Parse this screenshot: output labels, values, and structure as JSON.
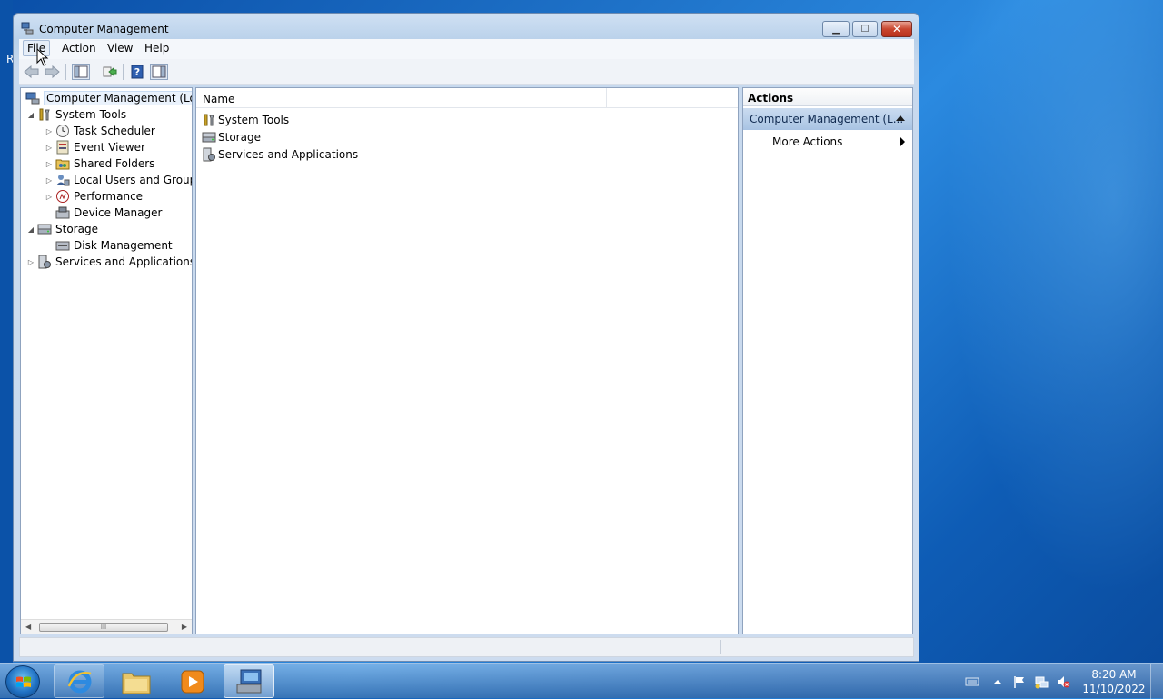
{
  "desktop": {
    "edge_letter": "R"
  },
  "window": {
    "title": "Computer Management",
    "icon": "computer-management-icon",
    "caption_buttons": [
      "minimize",
      "maximize",
      "close"
    ]
  },
  "menu": {
    "file": "File",
    "action": "Action",
    "view": "View",
    "help": "Help"
  },
  "toolbar": {
    "icons": [
      "back-arrow-icon",
      "forward-arrow-icon",
      "show-hide-console-tree-icon",
      "export-list-icon",
      "help-icon",
      "show-hide-action-pane-icon"
    ]
  },
  "tree": {
    "root": "Computer Management (Local",
    "items": [
      {
        "label": "System Tools",
        "icon": "system-tools-icon"
      },
      {
        "label": "Task Scheduler",
        "icon": "task-scheduler-icon"
      },
      {
        "label": "Event Viewer",
        "icon": "event-viewer-icon"
      },
      {
        "label": "Shared Folders",
        "icon": "shared-folders-icon"
      },
      {
        "label": "Local Users and Groups",
        "icon": "local-users-icon"
      },
      {
        "label": "Performance",
        "icon": "performance-icon"
      },
      {
        "label": "Device Manager",
        "icon": "device-manager-icon"
      },
      {
        "label": "Storage",
        "icon": "storage-icon"
      },
      {
        "label": "Disk Management",
        "icon": "disk-management-icon"
      },
      {
        "label": "Services and Applications",
        "icon": "services-applications-icon"
      }
    ],
    "scroll_thumb": "III"
  },
  "list": {
    "column_name": "Name",
    "rows": [
      "System Tools",
      "Storage",
      "Services and Applications"
    ]
  },
  "actions": {
    "header": "Actions",
    "section": "Computer Management (L...",
    "more": "More Actions"
  },
  "taskbar": {
    "apps": [
      "internet-explorer-icon",
      "windows-explorer-icon",
      "media-player-icon",
      "computer-management-icon"
    ],
    "tray_icons": [
      "keyboard-icon",
      "show-hidden-icons-chevron",
      "action-center-flag-icon",
      "network-icon",
      "volume-muted-icon"
    ],
    "time": "8:20 AM",
    "date": "11/10/2022"
  },
  "colors": {
    "accent": "#1f73c9",
    "selection": "#eaf2fc",
    "actions_section": "#a8c3e3",
    "close_button": "#c9462f"
  }
}
